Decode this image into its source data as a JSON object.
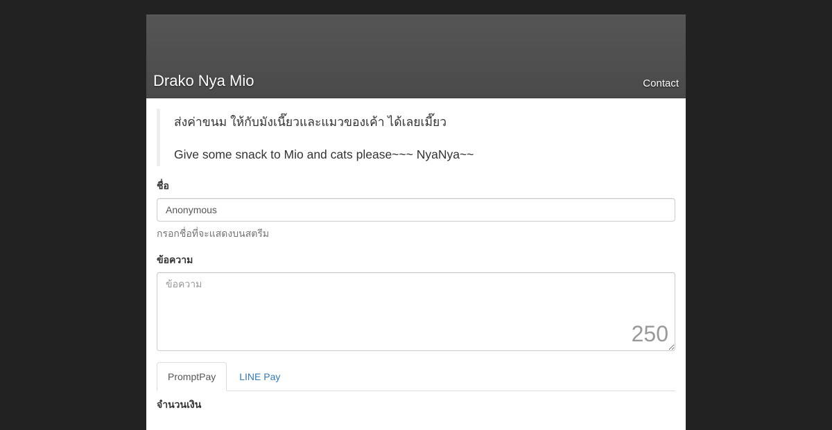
{
  "header": {
    "title": "Drako Nya Mio",
    "contact_label": "Contact"
  },
  "intro": {
    "line_thai": "ส่งค่าขนม ให้กับมังเนี๊ยวและแมวของเค้า ได้เลยเมี๊ยว",
    "line_en": "Give some snack to Mio and cats please~~~ NyaNya~~"
  },
  "form": {
    "name_label": "ชื่อ",
    "name_value": "Anonymous",
    "name_help": "กรอกชื่อที่จะแสดงบนสตรีม",
    "message_label": "ข้อความ",
    "message_placeholder": "ข้อความ",
    "char_count": "250",
    "amount_label": "จำนวนเงิน"
  },
  "tabs": [
    {
      "label": "PromptPay",
      "active": true
    },
    {
      "label": "LINE Pay",
      "active": false
    }
  ],
  "colors": {
    "page_bg": "#222222",
    "header_bg": "#555555",
    "link": "#337ab7"
  }
}
